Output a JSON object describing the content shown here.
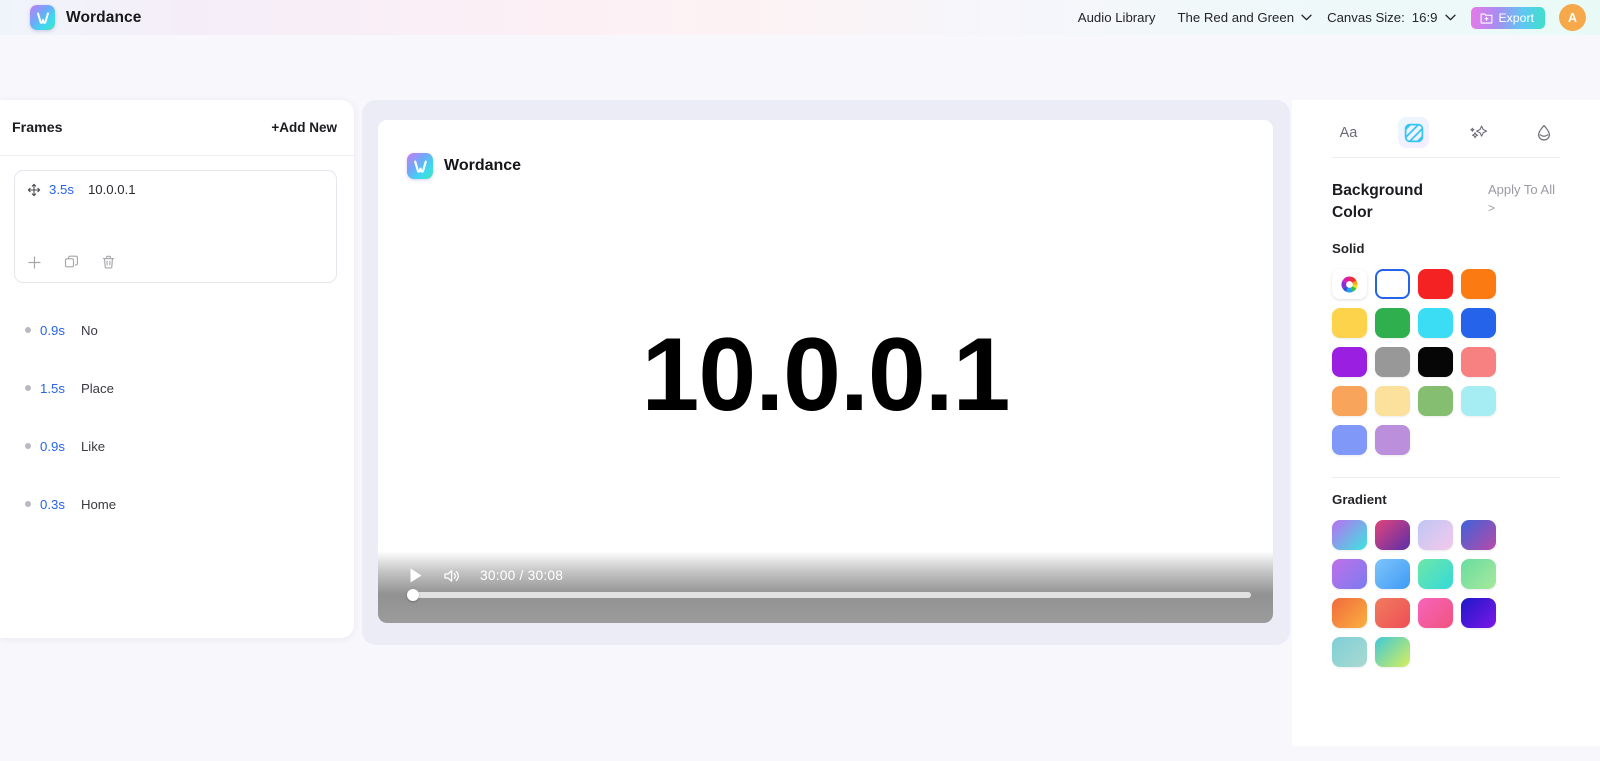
{
  "app": {
    "name": "Wordance",
    "logo_icon": "w-logo-icon"
  },
  "header": {
    "audio_library": "Audio Library",
    "project_name": "The Red and Green",
    "project_chevron_icon": "chevron-down-icon",
    "canvas_size_label": "Canvas Size:",
    "canvas_size_value": "16:9",
    "canvas_chevron_icon": "chevron-down-icon",
    "export_label": "Export",
    "export_icon": "export-folder-icon",
    "avatar_initial": "A",
    "avatar_color": "#F6A94A",
    "export_gradient": [
      "#E879E8",
      "#3EE0C8"
    ]
  },
  "frames_panel": {
    "title": "Frames",
    "add_new_label": "+Add New",
    "selected_frame": {
      "move_icon": "move-handle-icon",
      "duration": "3.5s",
      "text": "10.0.0.1",
      "tools": [
        {
          "icon": "plus-icon",
          "name": "add-frame"
        },
        {
          "icon": "duplicate-icon",
          "name": "duplicate-frame"
        },
        {
          "icon": "trash-icon",
          "name": "delete-frame"
        }
      ]
    },
    "items": [
      {
        "duration": "0.9s",
        "text": "No"
      },
      {
        "duration": "1.5s",
        "text": "Place"
      },
      {
        "duration": "0.9s",
        "text": "Like"
      },
      {
        "duration": "0.3s",
        "text": "Home"
      }
    ],
    "duration_color": "#2563EB"
  },
  "canvas": {
    "brand_name": "Wordance",
    "main_text": "10.0.0.1",
    "player": {
      "play_icon": "play-icon",
      "volume_icon": "volume-icon",
      "time": "30:00 / 30:08",
      "progress_percent": 0
    }
  },
  "right_panel": {
    "tabs": [
      {
        "label": "Aa",
        "icon": "text-icon",
        "name": "tab-text",
        "active": false
      },
      {
        "label": "",
        "icon": "background-stripes-icon",
        "name": "tab-background",
        "active": true
      },
      {
        "label": "",
        "icon": "sparkle-icon",
        "name": "tab-effects",
        "active": false
      },
      {
        "label": "",
        "icon": "droplet-icon",
        "name": "tab-color",
        "active": false
      }
    ],
    "background_color_title": "Background Color",
    "apply_to_all_label": "Apply To All",
    "apply_to_all_chevron": ">",
    "solid_label": "Solid",
    "gradient_label": "Gradient",
    "solid_swatches": [
      {
        "type": "picker",
        "name": "color-wheel-picker"
      },
      {
        "type": "selected",
        "color": "#FFFFFF",
        "name": "swatch-white"
      },
      {
        "type": "color",
        "color": "#F42222",
        "name": "swatch-red"
      },
      {
        "type": "color",
        "color": "#FC7A12",
        "name": "swatch-orange"
      },
      {
        "type": "color",
        "color": "#FCD34B",
        "name": "swatch-yellow"
      },
      {
        "type": "color",
        "color": "#2FAF4E",
        "name": "swatch-green"
      },
      {
        "type": "color",
        "color": "#3BDDF5",
        "name": "swatch-cyan"
      },
      {
        "type": "color",
        "color": "#2563EB",
        "name": "swatch-blue"
      },
      {
        "type": "color",
        "color": "#9B1FE0",
        "name": "swatch-purple"
      },
      {
        "type": "color",
        "color": "#989898",
        "name": "swatch-gray"
      },
      {
        "type": "color",
        "color": "#060606",
        "name": "swatch-black"
      },
      {
        "type": "color",
        "color": "#F78080",
        "name": "swatch-salmon"
      },
      {
        "type": "color",
        "color": "#F9A45B",
        "name": "swatch-light-orange"
      },
      {
        "type": "color",
        "color": "#FBE19B",
        "name": "swatch-cream"
      },
      {
        "type": "color",
        "color": "#85BE70",
        "name": "swatch-sage"
      },
      {
        "type": "color",
        "color": "#A5EDF2",
        "name": "swatch-pale-cyan"
      },
      {
        "type": "color",
        "color": "#8098F7",
        "name": "swatch-periwinkle"
      },
      {
        "type": "color",
        "color": "#BC8FDD",
        "name": "swatch-lilac"
      }
    ],
    "gradient_swatches": [
      {
        "from": "#B96FF0",
        "to": "#3BE6E0",
        "name": "gradient-purple-teal"
      },
      {
        "from": "#E0447B",
        "to": "#5C2FA8",
        "name": "gradient-pink-indigo"
      },
      {
        "from": "#BFC6F5",
        "to": "#F3C9EA",
        "name": "gradient-lavender-pink"
      },
      {
        "from": "#3E63D8",
        "to": "#B84AA8",
        "name": "gradient-blue-magenta"
      },
      {
        "from": "#C06FE8",
        "to": "#7A7CF0",
        "name": "gradient-violet-blue"
      },
      {
        "from": "#7FC4FB",
        "to": "#3E9BF5",
        "name": "gradient-sky-blue"
      },
      {
        "from": "#6EE7A8",
        "to": "#34D9D9",
        "name": "gradient-green-teal"
      },
      {
        "from": "#67DDA0",
        "to": "#A8E89C",
        "name": "gradient-mint-lime"
      },
      {
        "from": "#F06A3C",
        "to": "#FBB040",
        "name": "gradient-red-amber"
      },
      {
        "from": "#F07C5E",
        "to": "#EE4E55",
        "name": "gradient-coral-red"
      },
      {
        "from": "#F765BC",
        "to": "#F0527E",
        "name": "gradient-pink-rose"
      },
      {
        "from": "#1E18C8",
        "to": "#7C18E8",
        "name": "gradient-deep-blue-violet"
      },
      {
        "from": "#7FCFD8",
        "to": "#A9D9D0",
        "name": "gradient-aqua-soft"
      },
      {
        "from": "#3FC9D8",
        "to": "#D8EE5C",
        "name": "gradient-cyan-lime"
      }
    ]
  }
}
